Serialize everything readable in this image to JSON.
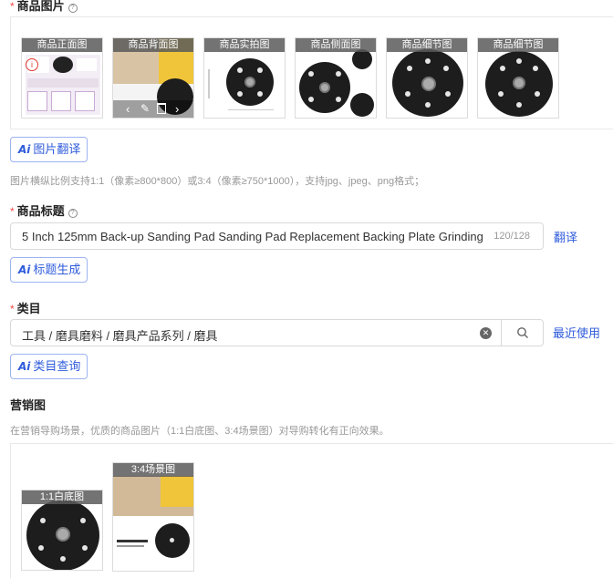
{
  "images_section": {
    "label": "商品图片",
    "thumbs": [
      {
        "caption": "商品正面图"
      },
      {
        "caption": "商品背面图"
      },
      {
        "caption": "商品实拍图"
      },
      {
        "caption": "商品侧面图"
      },
      {
        "caption": "商品细节图"
      },
      {
        "caption": "商品细节图"
      }
    ],
    "translate_button": "图片翻译",
    "hint": "图片横纵比例支持1:1（像素≥800*800）或3:4（像素≥750*1000），支持jpg、jpeg、png格式；"
  },
  "title_section": {
    "label": "商品标题",
    "value": "5 Inch 125mm Back-up Sanding Pad Sanding Pad Replacement Backing Plate Grinding Pad f",
    "count": "120/128",
    "translate_link": "翻译",
    "generate_button": "标题生成"
  },
  "category_section": {
    "label": "类目",
    "value": "工具 / 磨具磨料 / 磨具产品系列 / 磨具",
    "recent_link": "最近使用",
    "query_button": "类目查询"
  },
  "marketing_section": {
    "label": "营销图",
    "hint": "在营销导购场景，优质的商品图片（1:1白底图、3:4场景图）对导购转化有正向效果。",
    "images": [
      {
        "caption": "1:1白底图"
      },
      {
        "caption": "3:4场景图"
      }
    ]
  },
  "colors": {
    "accent": "#2e5bdb",
    "required": "#f54a45",
    "hint": "#999999"
  }
}
